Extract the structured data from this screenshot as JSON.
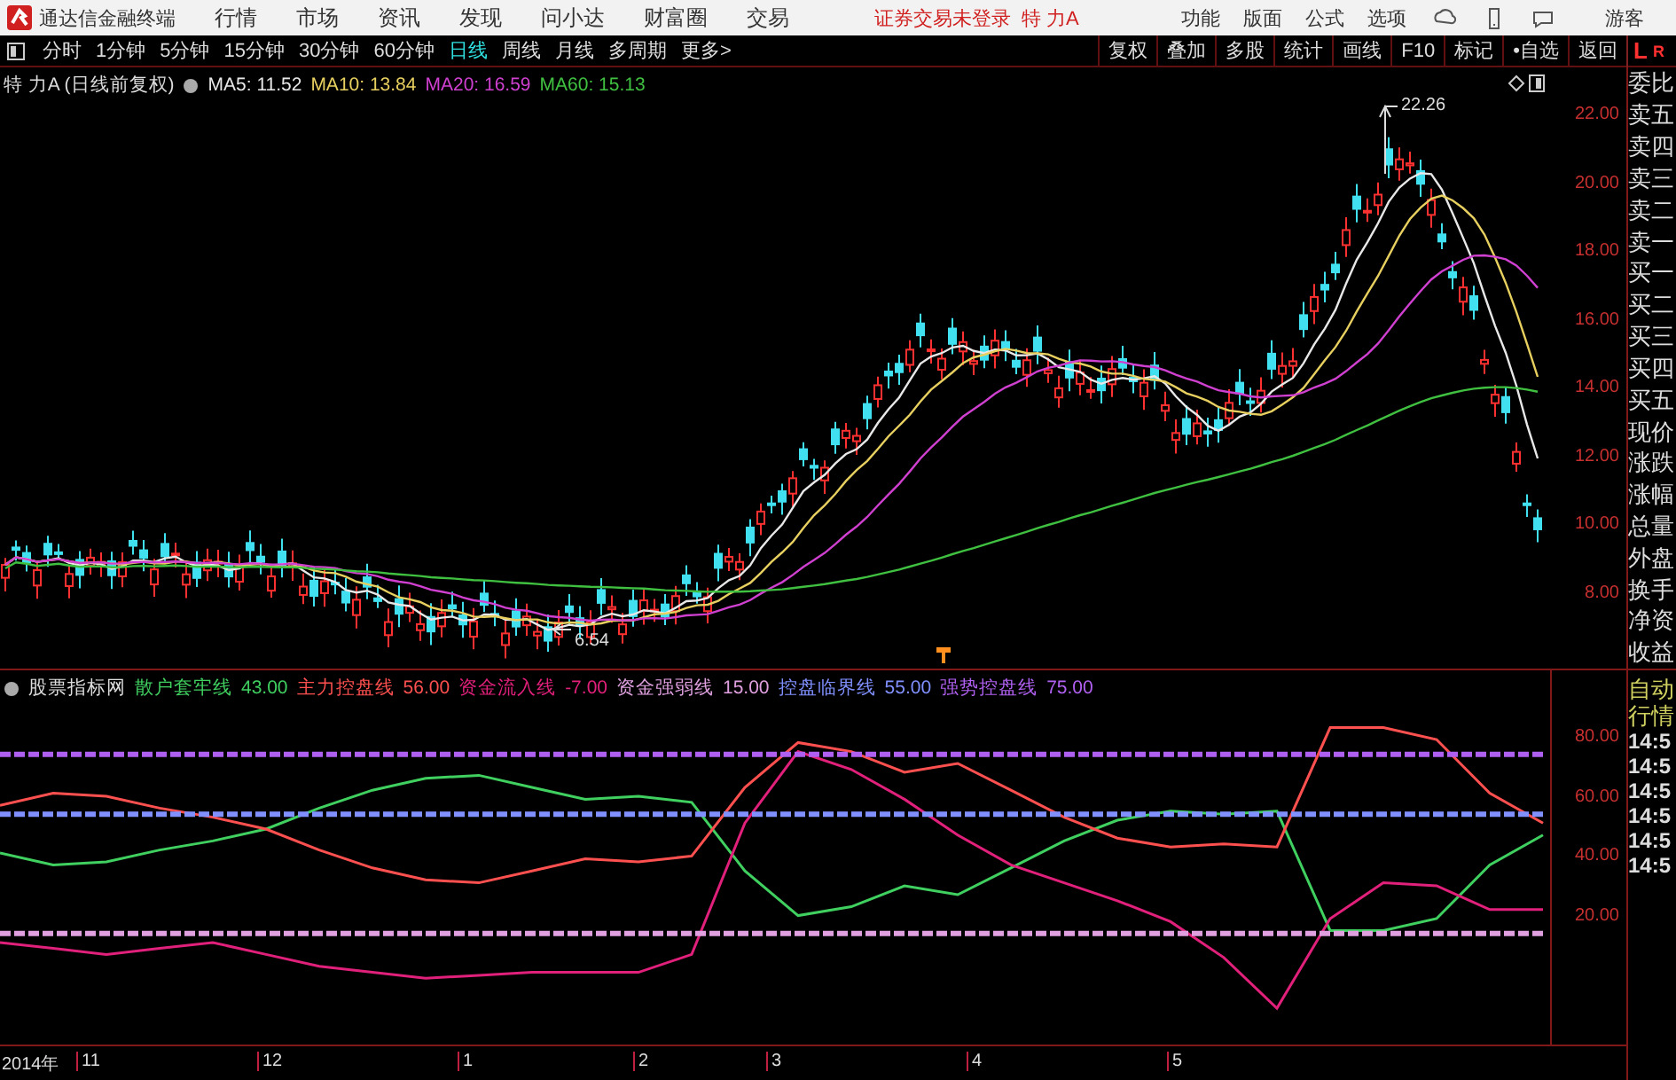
{
  "menu_bar": {
    "app_title": "通达信金融终端",
    "menus": [
      "行情",
      "市场",
      "资讯",
      "发现",
      "问小达",
      "财富圈",
      "交易"
    ],
    "login_status": "证券交易未登录",
    "stock_name": "特 力A",
    "tools": [
      "功能",
      "版面",
      "公式",
      "选项"
    ],
    "user": "游客"
  },
  "period_tabs": [
    {
      "label": "分时",
      "selected": false
    },
    {
      "label": "1分钟",
      "selected": false
    },
    {
      "label": "5分钟",
      "selected": false
    },
    {
      "label": "15分钟",
      "selected": false
    },
    {
      "label": "30分钟",
      "selected": false
    },
    {
      "label": "60分钟",
      "selected": false
    },
    {
      "label": "日线",
      "selected": true
    },
    {
      "label": "周线",
      "selected": false
    },
    {
      "label": "月线",
      "selected": false
    },
    {
      "label": "多周期",
      "selected": false
    },
    {
      "label": "更多>",
      "selected": false
    }
  ],
  "chart_tools": [
    "复权",
    "叠加",
    "多股",
    "统计",
    "画线",
    "F10",
    "标记",
    "•自选",
    "返回"
  ],
  "corner_logo": [
    "L",
    "R"
  ],
  "price_chart": {
    "stock_label": "特 力A (日线前复权)",
    "mas": [
      {
        "label": "MA5: 11.52",
        "color": "#e8e8e8"
      },
      {
        "label": "MA10: 13.84",
        "color": "#e8d060"
      },
      {
        "label": "MA20: 16.59",
        "color": "#d040d0"
      },
      {
        "label": "MA60: 15.13",
        "color": "#40c040"
      }
    ],
    "y_labels": [
      "22.00",
      "20.00",
      "18.00",
      "16.00",
      "14.00",
      "12.00",
      "10.00",
      "8.00"
    ],
    "high_marker": "22.26",
    "low_marker": "6.54"
  },
  "indicator": {
    "name": "股票指标网",
    "readings": [
      "43.00",
      "56.00",
      "-7.00",
      "15.00",
      "55.00",
      "75.00"
    ],
    "chart_data": {
      "type": "line",
      "ylim": [
        -22.2,
        103.2
      ],
      "yticks": [
        {
          "value": 80,
          "label": "80.00"
        },
        {
          "value": 60,
          "label": "60.00"
        },
        {
          "value": 40,
          "label": "40.00"
        },
        {
          "value": 20,
          "label": "20.00"
        }
      ],
      "series": [
        {
          "name": "散户套牢线",
          "color": "#40d060",
          "values": [
            42,
            38,
            39,
            43,
            46,
            50,
            57,
            63,
            67,
            68,
            64,
            60,
            61,
            59,
            36,
            21,
            24,
            31,
            28,
            37,
            46,
            53,
            56,
            55,
            56,
            16,
            16,
            20,
            38,
            48
          ]
        },
        {
          "name": "主力控盘线",
          "color": "#ff5050",
          "values": [
            58,
            62,
            61,
            57,
            54,
            50,
            43,
            37,
            33,
            32,
            36,
            40,
            39,
            41,
            64,
            79,
            76,
            69,
            72,
            63,
            54,
            47,
            44,
            45,
            44,
            84,
            84,
            80,
            62,
            52
          ]
        },
        {
          "name": "资金流入线",
          "color": "#e0207a",
          "values": [
            12,
            10,
            8,
            10,
            12,
            8,
            4,
            2,
            0,
            1,
            2,
            2,
            2,
            8,
            52,
            76,
            70,
            60,
            48,
            38,
            32,
            26,
            19,
            7,
            -10,
            20,
            32,
            31,
            23,
            23
          ]
        },
        {
          "name": "资金强弱线",
          "color": "#e0a0e0",
          "line_style": "dashed",
          "values": [
            15,
            15,
            15,
            15,
            15,
            15,
            15,
            15,
            15,
            15,
            15,
            15,
            15,
            15,
            15,
            15,
            15,
            15,
            15,
            15,
            15,
            15,
            15,
            15,
            15,
            15,
            15,
            15,
            15,
            15
          ]
        },
        {
          "name": "控盘临界线",
          "color": "#8090ff",
          "line_style": "dashed",
          "values": [
            55,
            55,
            55,
            55,
            55,
            55,
            55,
            55,
            55,
            55,
            55,
            55,
            55,
            55,
            55,
            55,
            55,
            55,
            55,
            55,
            55,
            55,
            55,
            55,
            55,
            55,
            55,
            55,
            55,
            55
          ]
        },
        {
          "name": "强势控盘线",
          "color": "#b060f0",
          "line_style": "dashed",
          "values": [
            75,
            75,
            75,
            75,
            75,
            75,
            75,
            75,
            75,
            75,
            75,
            75,
            75,
            75,
            75,
            75,
            75,
            75,
            75,
            75,
            75,
            75,
            75,
            75,
            75,
            75,
            75,
            75,
            75,
            75
          ]
        }
      ]
    }
  },
  "quote_panel": {
    "fields": [
      "委比",
      "卖五",
      "卖四",
      "卖三",
      "卖二",
      "卖一",
      "买一",
      "买二",
      "买三",
      "买四",
      "买五",
      "现价",
      "涨跌",
      "涨幅",
      "总量",
      "外盘",
      "换手",
      "净资",
      "收益"
    ],
    "mode": [
      "自动",
      "行情"
    ],
    "times": [
      "14:5",
      "14:5",
      "14:5",
      "14:5",
      "14:5",
      "14:5"
    ]
  },
  "time_axis": [
    "2014年",
    "11",
    "12",
    "1",
    "2",
    "3",
    "4",
    "5"
  ]
}
